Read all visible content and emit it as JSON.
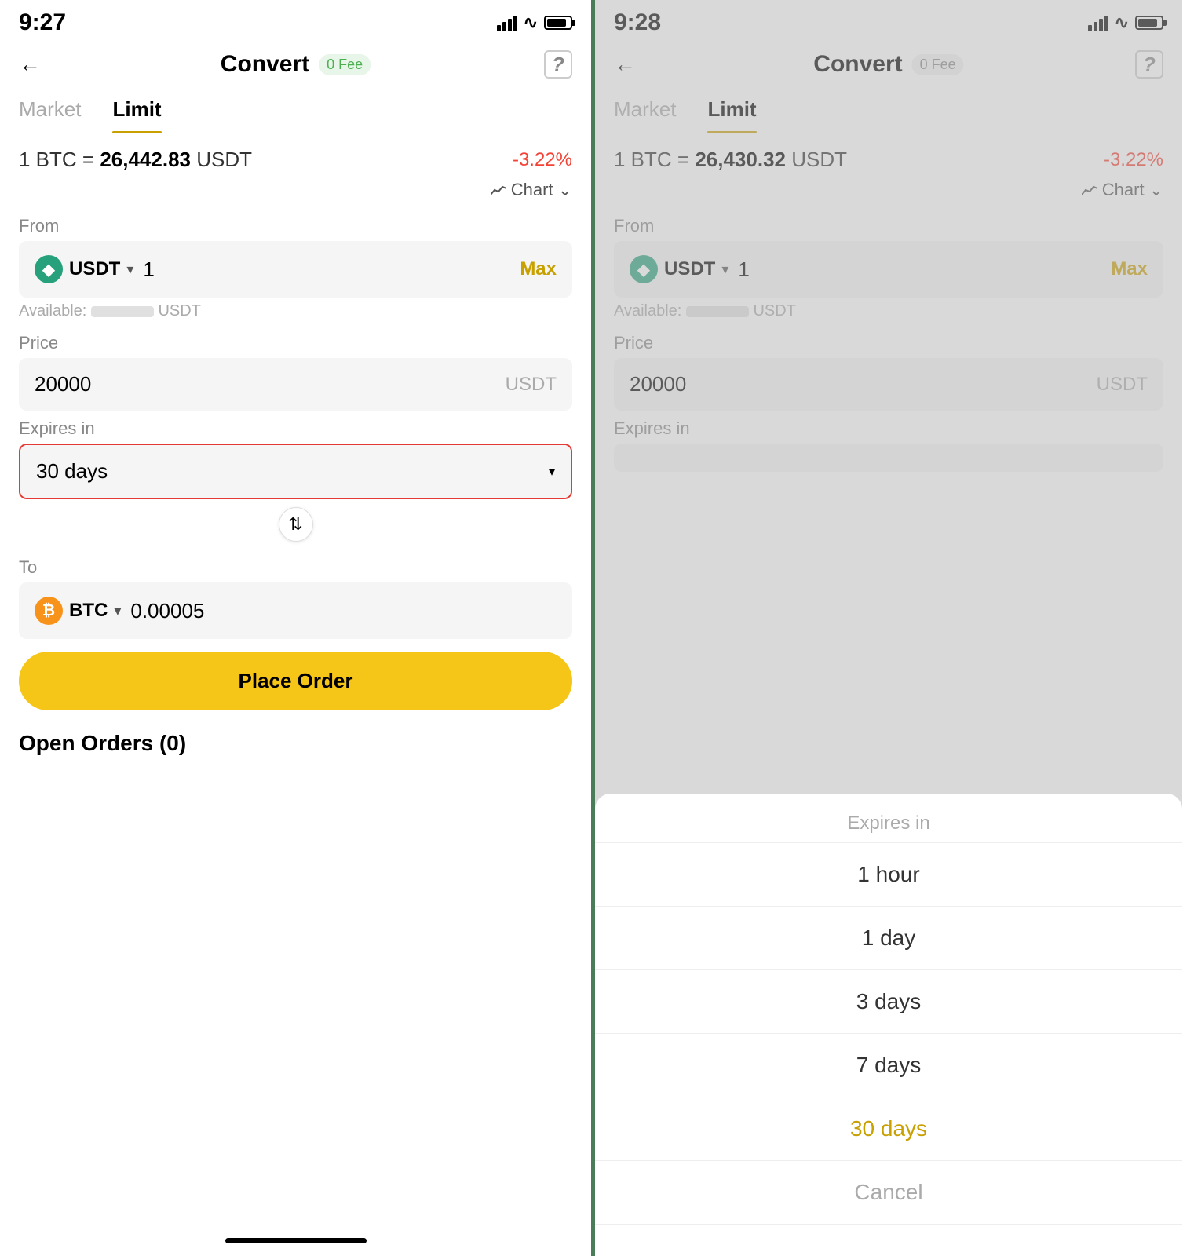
{
  "left": {
    "statusBar": {
      "time": "9:27"
    },
    "header": {
      "title": "Convert",
      "feeBadge": "0 Fee",
      "feeBadgeColor": "green"
    },
    "tabs": [
      {
        "label": "Market",
        "active": false
      },
      {
        "label": "Limit",
        "active": true
      }
    ],
    "rate": {
      "prefix": "1 BTC =",
      "value": "26,442.83",
      "suffix": "USDT",
      "change": "-3.22%"
    },
    "chartBtn": "Chart",
    "from": {
      "label": "From",
      "currency": "USDT",
      "amount": "1",
      "maxLabel": "Max",
      "availableLabel": "Available:",
      "availableSuffix": "USDT"
    },
    "price": {
      "label": "Price",
      "value": "20000",
      "unit": "USDT"
    },
    "expires": {
      "label": "Expires in",
      "value": "30 days",
      "highlighted": true
    },
    "to": {
      "label": "To",
      "currency": "BTC",
      "amount": "0.00005"
    },
    "placeOrderBtn": "Place Order",
    "openOrders": "Open Orders (0)"
  },
  "right": {
    "statusBar": {
      "time": "9:28"
    },
    "header": {
      "title": "Convert",
      "feeBadge": "0 Fee",
      "feeBadgeColor": "gray"
    },
    "tabs": [
      {
        "label": "Market",
        "active": false
      },
      {
        "label": "Limit",
        "active": true
      }
    ],
    "rate": {
      "prefix": "1 BTC =",
      "value": "26,430.32",
      "suffix": "USDT",
      "change": "-3.22%"
    },
    "chartBtn": "Chart",
    "from": {
      "label": "From",
      "currency": "USDT",
      "amount": "1",
      "maxLabel": "Max",
      "availableLabel": "Available:",
      "availableSuffix": "USDT"
    },
    "price": {
      "label": "Price",
      "value": "20000",
      "unit": "USDT"
    },
    "expires": {
      "label": "Expires in",
      "value": ""
    },
    "picker": {
      "title": "Expires in",
      "items": [
        {
          "label": "1 hour",
          "selected": false
        },
        {
          "label": "1 day",
          "selected": false
        },
        {
          "label": "3 days",
          "selected": false
        },
        {
          "label": "7 days",
          "selected": false
        },
        {
          "label": "30 days",
          "selected": true
        },
        {
          "label": "Cancel",
          "isCancel": true
        }
      ]
    }
  }
}
